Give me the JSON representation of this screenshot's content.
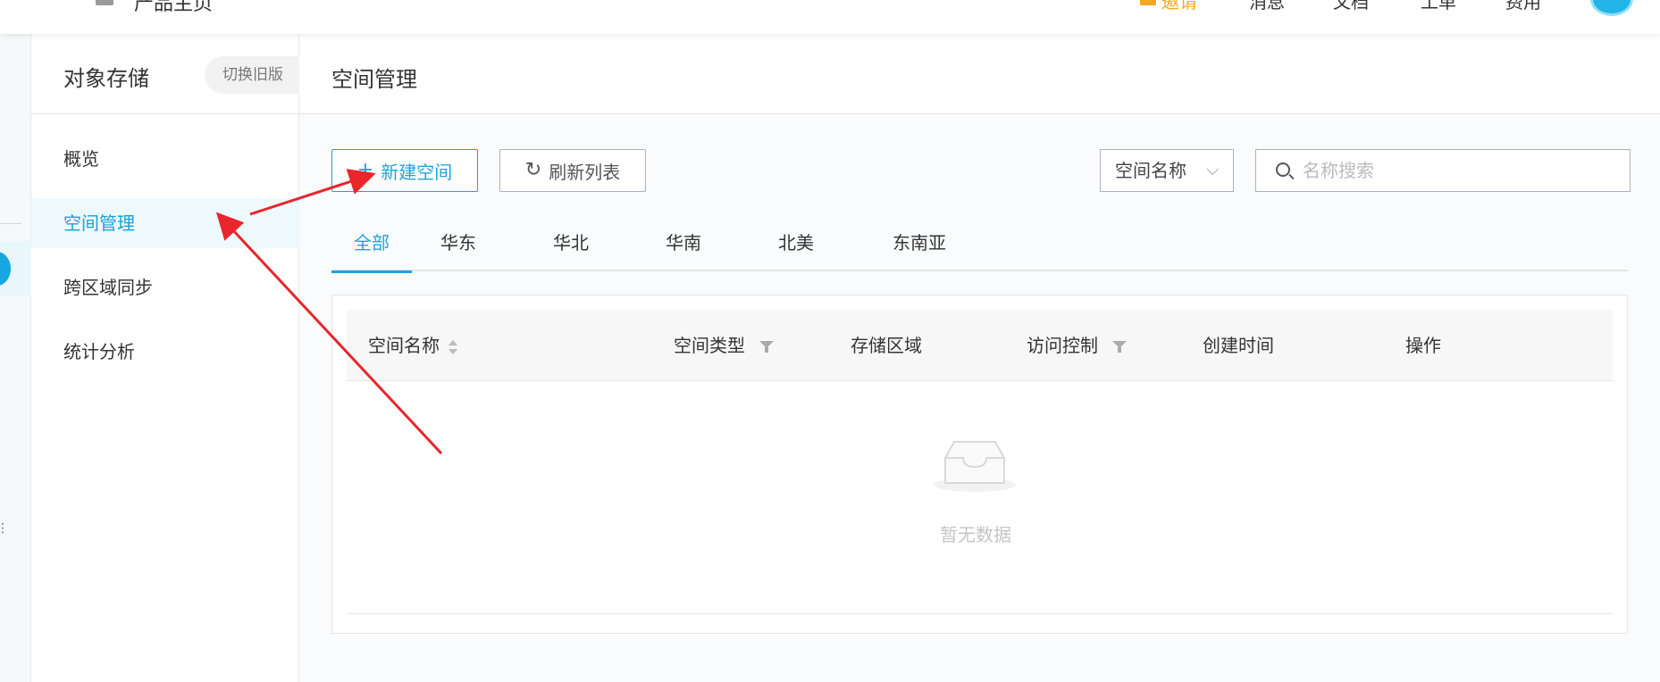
{
  "topbar": {
    "product_text": "产品主页",
    "nav": {
      "gift": "邀请",
      "messages": "消息",
      "docs": "文档",
      "tickets": "工单",
      "billing": "费用"
    }
  },
  "sidebar": {
    "title": "对象存储",
    "switch_label": "切换旧版",
    "items": [
      {
        "label": "概览"
      },
      {
        "label": "空间管理"
      },
      {
        "label": "跨区域同步"
      },
      {
        "label": "统计分析"
      }
    ]
  },
  "main": {
    "page_title": "空间管理",
    "toolbar": {
      "new_space": "新建空间",
      "refresh_list": "刷新列表",
      "search_field_select": "空间名称",
      "search_placeholder": "名称搜索"
    },
    "tabs": [
      {
        "label": "全部"
      },
      {
        "label": "华东"
      },
      {
        "label": "华北"
      },
      {
        "label": "华南"
      },
      {
        "label": "北美"
      },
      {
        "label": "东南亚"
      }
    ],
    "table": {
      "columns": [
        "空间名称",
        "空间类型",
        "存储区域",
        "访问控制",
        "创建时间",
        "操作"
      ],
      "empty_text": "暂无数据"
    }
  },
  "colors": {
    "accent": "#1ea3dc",
    "annotation": "#e8262b",
    "gift": "#f5a623"
  }
}
